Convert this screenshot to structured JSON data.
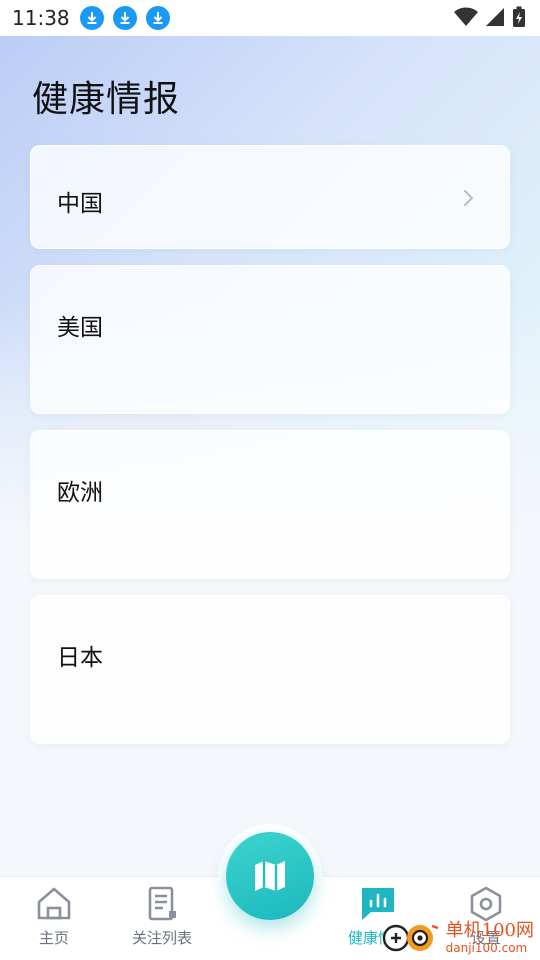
{
  "status_bar": {
    "time": "11:38",
    "icons": [
      "download-icon",
      "download-icon",
      "download-icon",
      "wifi-icon",
      "signal-icon",
      "battery-charging-icon"
    ]
  },
  "page": {
    "title": "健康情报"
  },
  "regions": [
    {
      "label": "中国",
      "has_chevron": true
    },
    {
      "label": "美国"
    },
    {
      "label": "欧洲"
    },
    {
      "label": "日本"
    }
  ],
  "bottom_nav": {
    "items": [
      {
        "label": "主页",
        "icon": "home-icon"
      },
      {
        "label": "关注列表",
        "icon": "list-icon"
      },
      {
        "label": "健康情报",
        "icon": "chart-icon",
        "active": true
      },
      {
        "label": "设置",
        "icon": "settings-icon"
      }
    ],
    "fab_icon": "map-icon"
  },
  "watermark": {
    "text_cn": "单机100网",
    "text_en": "danji100.com"
  },
  "colors": {
    "accent": "#1fb5c2",
    "status_download": "#1a9af5",
    "watermark": "#e8511f"
  }
}
